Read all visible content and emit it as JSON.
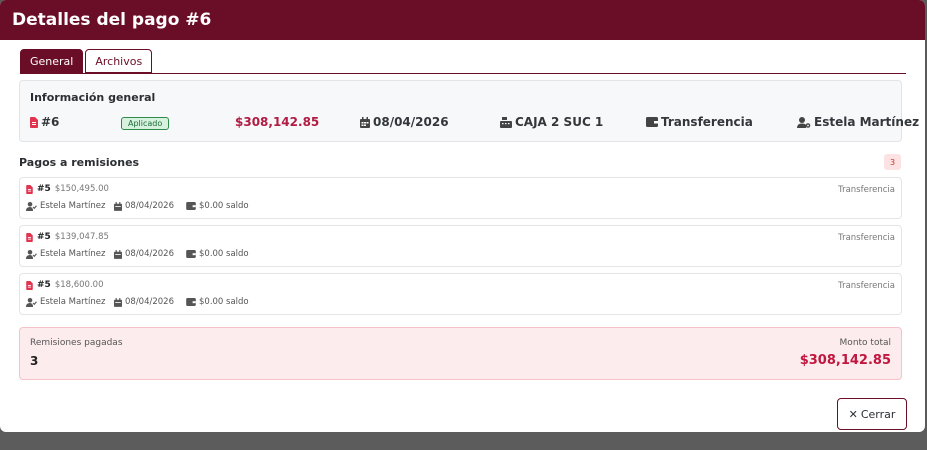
{
  "modal": {
    "title": "Detalles del pago #6"
  },
  "tabs": [
    {
      "label": "General"
    },
    {
      "label": "Archivos"
    }
  ],
  "info": {
    "title": "Información general",
    "id": "#6",
    "status": "Aplicado",
    "amount": "$308,142.85",
    "date": "08/04/2026",
    "register": "CAJA 2 SUC 1",
    "method": "Transferencia",
    "user": "Estela Martínez"
  },
  "remisiones": {
    "title": "Pagos a remisiones",
    "count": "3",
    "items": [
      {
        "num": "#5",
        "amount": "$150,495.00",
        "method": "Transferencia",
        "user": "Estela Martínez",
        "date": "08/04/2026",
        "saldo": "$0.00 saldo"
      },
      {
        "num": "#5",
        "amount": "$139,047.85",
        "method": "Transferencia",
        "user": "Estela Martínez",
        "date": "08/04/2026",
        "saldo": "$0.00 saldo"
      },
      {
        "num": "#5",
        "amount": "$18,600.00",
        "method": "Transferencia",
        "user": "Estela Martínez",
        "date": "08/04/2026",
        "saldo": "$0.00 saldo"
      }
    ]
  },
  "totals": {
    "left_label": "Remisiones pagadas",
    "left_value": "3",
    "right_label": "Monto total",
    "right_value": "$308,142.85"
  },
  "footer": {
    "close_label": "Cerrar",
    "close_glyph": "✕"
  },
  "colors": {
    "brand": "#6a0d26",
    "accent_red": "#c0173f",
    "success": "#2f8a4a"
  }
}
